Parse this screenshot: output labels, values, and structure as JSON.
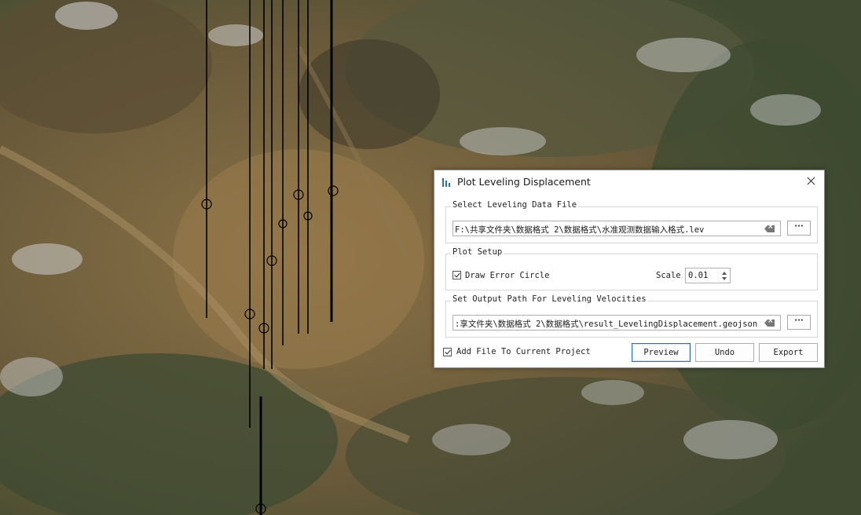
{
  "dialog": {
    "title": "Plot Leveling Displacement",
    "icon": "bar-chart-icon",
    "data_file_group": {
      "label": "Select Leveling Data File",
      "path_value": "F:\\共享文件夹\\数据格式 2\\数据格式\\水准观测数据输入格式.lev",
      "browse_label": "···"
    },
    "plot_setup_group": {
      "label": "Plot Setup",
      "draw_error_circle_label": "Draw Error Circle",
      "draw_error_circle_checked": true,
      "scale_label": "Scale",
      "scale_value": "0.01"
    },
    "output_group": {
      "label": "Set Output Path For Leveling Velocities",
      "path_value": ":享文件夹\\数据格式 2\\数据格式\\result_LevelingDisplacement.geojson",
      "browse_label": "···"
    },
    "add_to_project_label": "Add File To Current Project",
    "add_to_project_checked": true,
    "buttons": {
      "preview": "Preview",
      "undo": "Undo",
      "export": "Export"
    }
  },
  "colors": {
    "accent": "#2f6fb3",
    "map_base": "#6b5a3c"
  }
}
